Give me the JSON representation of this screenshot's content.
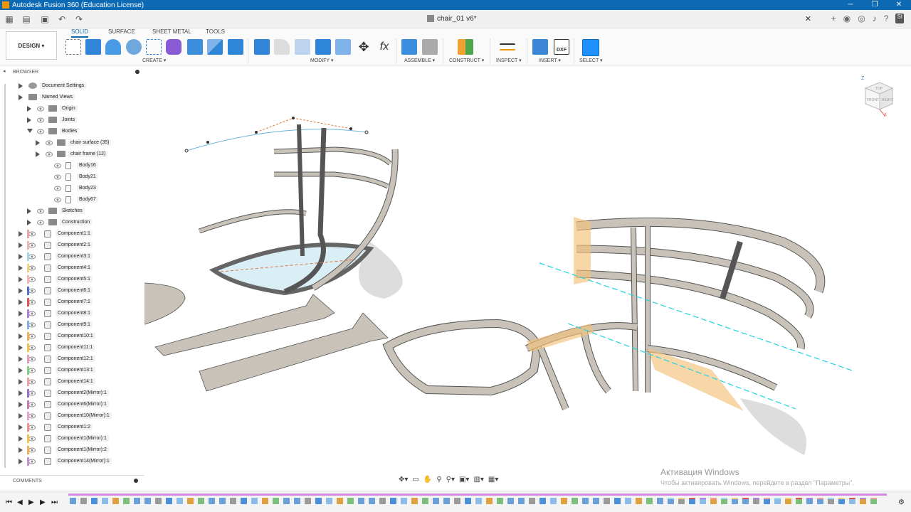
{
  "titlebar": {
    "title": "Autodesk Fusion 360 (Education License)"
  },
  "document": {
    "tab_title": "chair_01 v6*"
  },
  "workspace": {
    "label": "DESIGN ▾"
  },
  "tabs": [
    "SOLID",
    "SURFACE",
    "SHEET METAL",
    "TOOLS"
  ],
  "groups": [
    "CREATE ▾",
    "MODIFY ▾",
    "ASSEMBLE ▾",
    "CONSTRUCT ▾",
    "INSPECT ▾",
    "INSERT ▾",
    "SELECT ▾"
  ],
  "browser": {
    "title": "BROWSER",
    "items": [
      {
        "label": "Document Settings"
      },
      {
        "label": "Named Views"
      },
      {
        "label": "Origin"
      },
      {
        "label": "Joints"
      },
      {
        "label": "Bodies"
      },
      {
        "label": "chair surface (35)"
      },
      {
        "label": "chair frame (12)"
      },
      {
        "label": "Body16"
      },
      {
        "label": "Body21"
      },
      {
        "label": "Body23"
      },
      {
        "label": "Body67"
      },
      {
        "label": "Sketches"
      },
      {
        "label": "Construction"
      },
      {
        "label": "Component1:1"
      },
      {
        "label": "Component2:1"
      },
      {
        "label": "Component3:1"
      },
      {
        "label": "Component4:1"
      },
      {
        "label": "Component5:1"
      },
      {
        "label": "Component6:1"
      },
      {
        "label": "Component7:1"
      },
      {
        "label": "Component8:1"
      },
      {
        "label": "Component9:1"
      },
      {
        "label": "Component10:1"
      },
      {
        "label": "Component11:1"
      },
      {
        "label": "Component12:1"
      },
      {
        "label": "Component13:1"
      },
      {
        "label": "Component14:1"
      },
      {
        "label": "Component2(Mirror):1"
      },
      {
        "label": "Component6(Mirror):1"
      },
      {
        "label": "Component10(Mirror):1"
      },
      {
        "label": "Component1:2"
      },
      {
        "label": "Component1(Mirror):1"
      },
      {
        "label": "Component1(Mirror):2"
      },
      {
        "label": "Component14(Mirror):1"
      }
    ]
  },
  "comments": {
    "label": "COMMENTS"
  },
  "viewcube": {
    "top": "TOP",
    "front": "FRONT",
    "right": "RIGHT",
    "z": "Z",
    "x": "X"
  },
  "watermark": {
    "line1": "Активация Windows",
    "line2": "Чтобы активировать Windows, перейдите в раздел \"Параметры\"."
  },
  "colors": {
    "accent": "#0b6ab3",
    "titlebar": "#0b6ab3",
    "body": "#c8c2b8",
    "highlight": "#f2c27a",
    "cyan": "#1fd3e0"
  }
}
